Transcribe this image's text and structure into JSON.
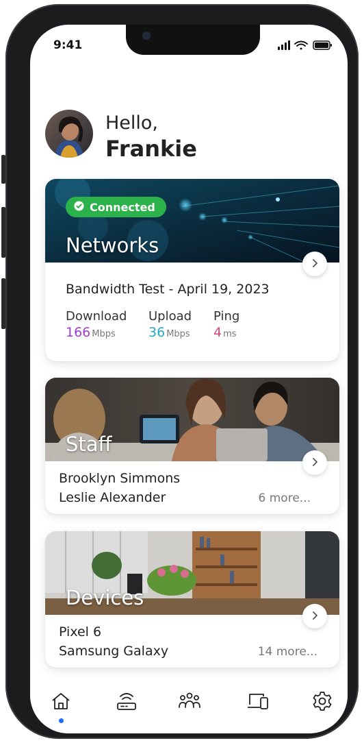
{
  "status_bar": {
    "time": "9:41"
  },
  "user": {
    "greeting": "Hello,",
    "name": "Frankie"
  },
  "networks_card": {
    "title": "Networks",
    "status_badge": "Connected",
    "test_title": "Bandwidth Test - April 19, 2023",
    "metrics": [
      {
        "label": "Download",
        "value": "166",
        "unit": "Mbps",
        "color": "#9b3fd0"
      },
      {
        "label": "Upload",
        "value": "36",
        "unit": "Mbps",
        "color": "#27a8c4"
      },
      {
        "label": "Ping",
        "value": "4",
        "unit": "ms",
        "color": "#e0447c"
      }
    ]
  },
  "staff_card": {
    "title": "Staff",
    "items": [
      "Brooklyn Simmons",
      "Leslie Alexander"
    ],
    "more": "6 more..."
  },
  "devices_card": {
    "title": "Devices",
    "items": [
      "Pixel 6",
      "Samsung Galaxy"
    ],
    "more": "14 more..."
  },
  "nav": {
    "items": [
      {
        "icon": "home-icon",
        "active": true
      },
      {
        "icon": "router-icon",
        "active": false
      },
      {
        "icon": "users-icon",
        "active": false
      },
      {
        "icon": "devices-icon",
        "active": false
      },
      {
        "icon": "gear-icon",
        "active": false
      }
    ]
  },
  "colors": {
    "accent": "#1e6cff",
    "connected": "#2cb24a"
  }
}
